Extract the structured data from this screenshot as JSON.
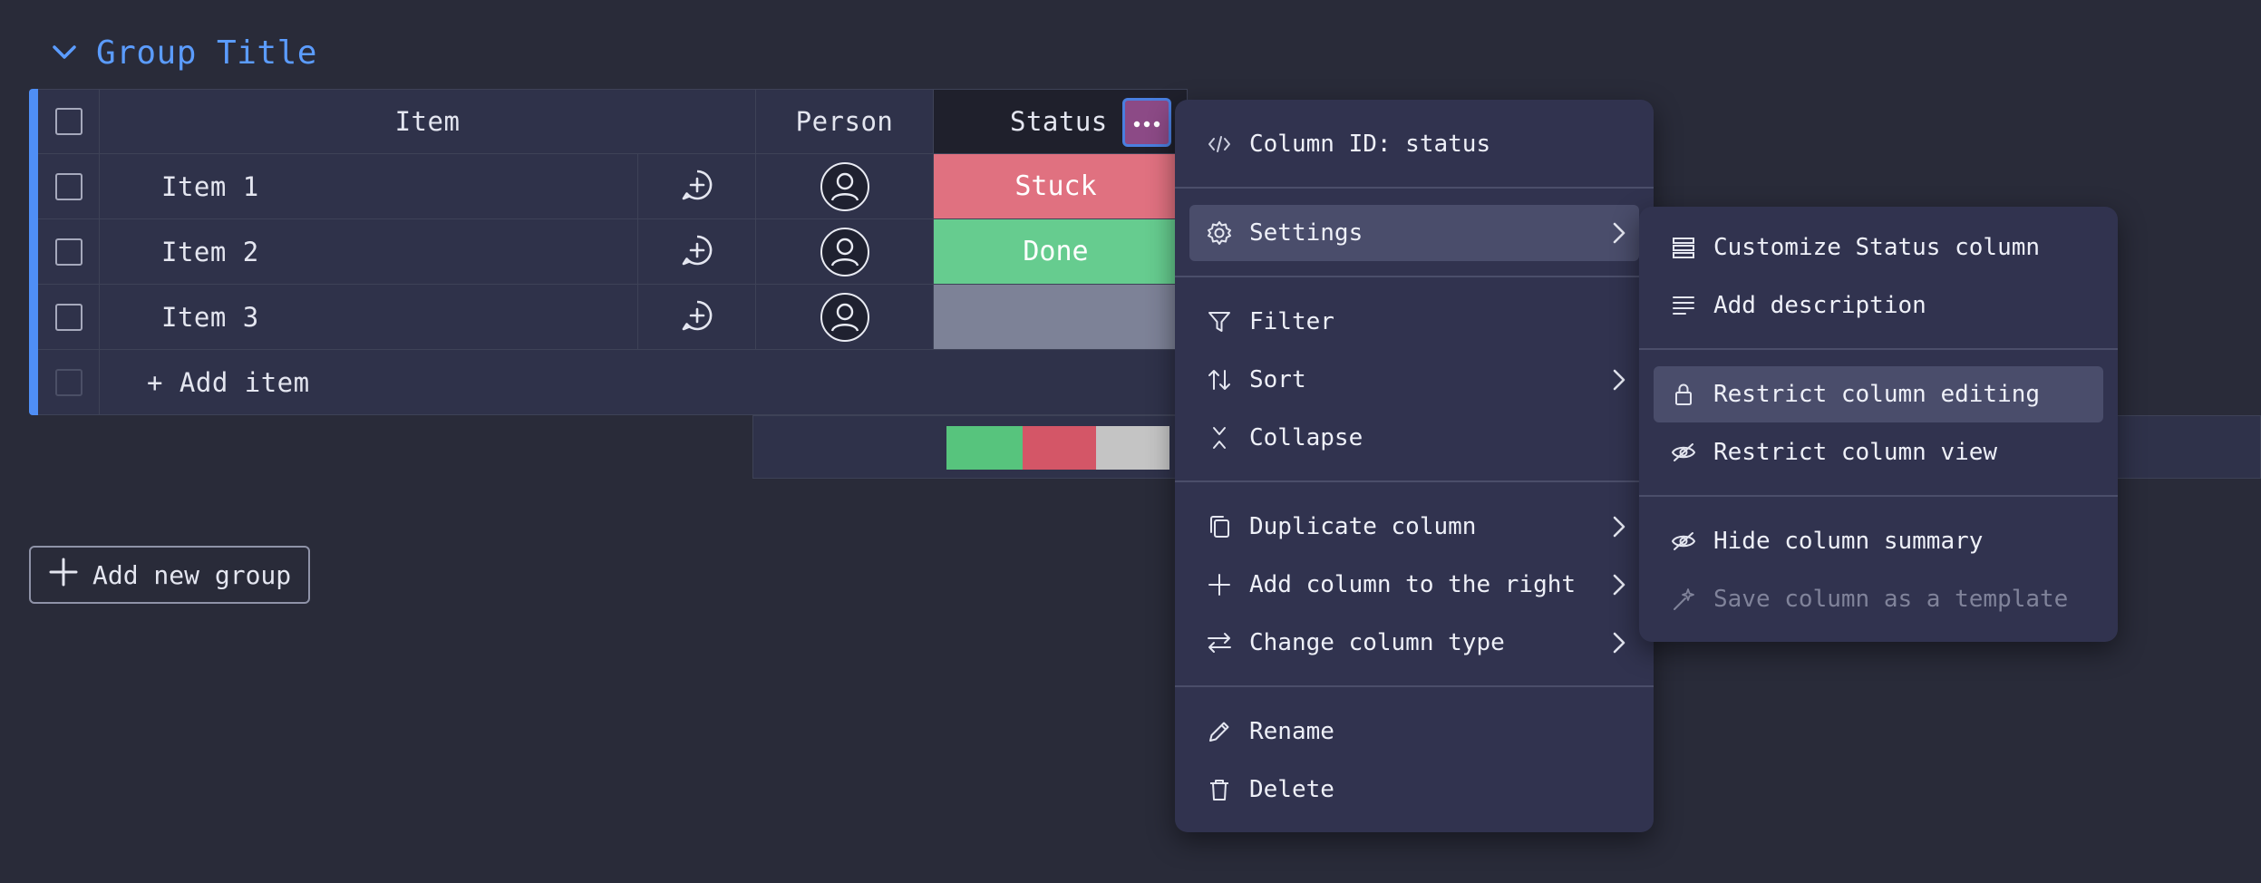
{
  "group": {
    "title": "Group Title"
  },
  "table": {
    "columns": {
      "item": "Item",
      "person": "Person",
      "status": "Status"
    },
    "rows": [
      {
        "name": "Item 1",
        "status": "Stuck"
      },
      {
        "name": "Item 2",
        "status": "Done"
      },
      {
        "name": "Item 3",
        "status": ""
      }
    ],
    "add_item": "+ Add item"
  },
  "status_summary": [
    {
      "label": "Done",
      "fraction": 0.34,
      "color": "#57c47d"
    },
    {
      "label": "Stuck",
      "fraction": 0.33,
      "color": "#d45667"
    },
    {
      "label": "",
      "fraction": 0.33,
      "color": "#c4c4c4"
    }
  ],
  "add_group_label": "Add new group",
  "column_menu": {
    "column_id": "Column ID: status",
    "settings": "Settings",
    "filter": "Filter",
    "sort": "Sort",
    "collapse": "Collapse",
    "duplicate": "Duplicate column",
    "add_right": "Add column to the right",
    "change_type": "Change column type",
    "rename": "Rename",
    "delete": "Delete"
  },
  "settings_submenu": {
    "customize": "Customize Status column",
    "add_description": "Add description",
    "restrict_editing": "Restrict column editing",
    "restrict_view": "Restrict column view",
    "hide_summary": "Hide column summary",
    "save_template": "Save column as a template"
  },
  "colors": {
    "accent": "#5b9cff",
    "stuck": "#e07180",
    "done": "#66cc8f",
    "menu_bg": "#31334f",
    "page_bg": "#292b39"
  }
}
